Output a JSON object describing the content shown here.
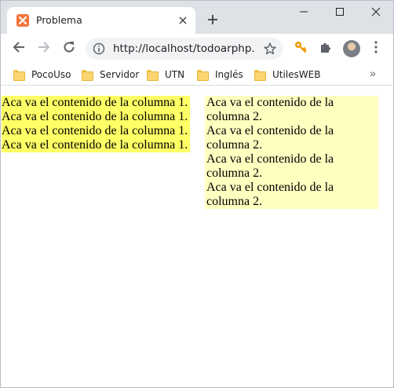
{
  "tab": {
    "title": "Problema",
    "favicon": "xampp-icon"
  },
  "window_controls": {
    "minimize": "minimize-icon",
    "maximize": "maximize-icon",
    "close": "close-icon"
  },
  "toolbar": {
    "url": "http://localhost/todoarphp...",
    "info_icon": "info-icon",
    "star_icon": "star-icon"
  },
  "bookmarks": [
    {
      "label": "PocoUso"
    },
    {
      "label": "Servidor"
    },
    {
      "label": "UTN"
    },
    {
      "label": "Inglés"
    },
    {
      "label": "UtilesWEB"
    }
  ],
  "bookmarks_more": "»",
  "content": {
    "column1": {
      "background": "#ffff66",
      "lines": [
        "Aca va el contenido de la columna 1.",
        "Aca va el contenido de la columna 1.",
        "Aca va el contenido de la columna 1.",
        "Aca va el contenido de la columna 1."
      ]
    },
    "column2": {
      "background": "#ffffc0",
      "lines": [
        "Aca va el contenido de la columna 2.",
        "Aca va el contenido de la columna 2.",
        "Aca va el contenido de la columna 2.",
        "Aca va el contenido de la columna 2."
      ]
    }
  }
}
